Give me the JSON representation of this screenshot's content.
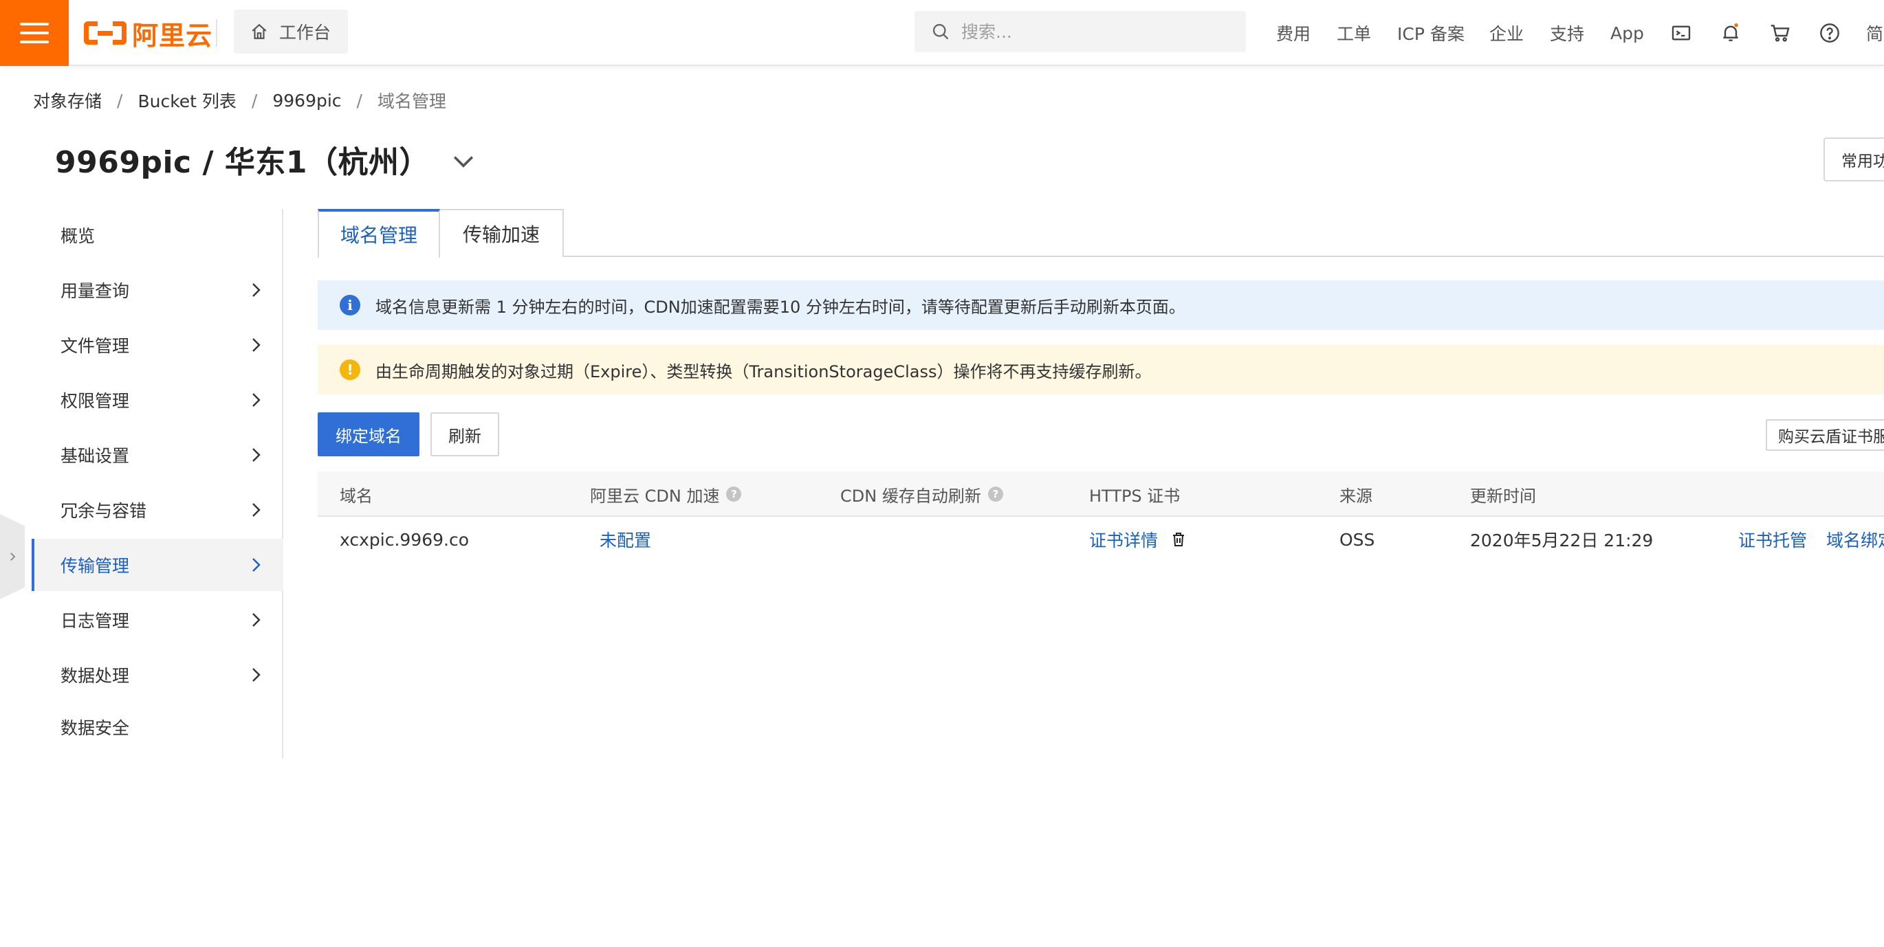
{
  "topbar": {
    "logo_text": "阿里云",
    "workbench_label": "工作台",
    "search_placeholder": "搜索...",
    "nav": [
      "费用",
      "工单",
      "ICP 备案",
      "企业",
      "支持",
      "App"
    ],
    "lang_label": "简",
    "icons": [
      "terminal-icon",
      "bell-icon",
      "cart-icon",
      "help-icon"
    ],
    "notification_dot_color": "#ff6a00"
  },
  "breadcrumb": [
    "对象存储",
    "Bucket 列表",
    "9969pic",
    "域名管理"
  ],
  "page_title": "9969pic / 华东1（杭州）",
  "common_functions_label": "常用功",
  "sidemenu": {
    "items": [
      {
        "label": "概览",
        "has_arrow": false
      },
      {
        "label": "用量查询",
        "has_arrow": true
      },
      {
        "label": "文件管理",
        "has_arrow": true
      },
      {
        "label": "权限管理",
        "has_arrow": true
      },
      {
        "label": "基础设置",
        "has_arrow": true
      },
      {
        "label": "冗余与容错",
        "has_arrow": true
      },
      {
        "label": "传输管理",
        "has_arrow": true,
        "active": true
      },
      {
        "label": "日志管理",
        "has_arrow": true
      },
      {
        "label": "数据处理",
        "has_arrow": true
      },
      {
        "label": "数据安全",
        "has_arrow": false
      }
    ]
  },
  "tabs": [
    {
      "label": "域名管理",
      "active": true
    },
    {
      "label": "传输加速",
      "active": false
    }
  ],
  "alerts": {
    "info": "域名信息更新需 1 分钟左右的时间，CDN加速配置需要10 分钟左右时间，请等待配置更新后手动刷新本页面。",
    "warning": "由生命周期触发的对象过期（Expire）、类型转换（TransitionStorageClass）操作将不再支持缓存刷新。"
  },
  "buttons": {
    "bind_domain": "绑定域名",
    "refresh": "刷新",
    "buy_cert": "购买云盾证书服"
  },
  "table": {
    "columns": [
      "域名",
      "阿里云 CDN 加速",
      "CDN 缓存自动刷新",
      "HTTPS 证书",
      "来源",
      "更新时间"
    ],
    "rows": [
      {
        "domain": "xcxpic.9969.co",
        "cdn": "未配置",
        "cdn_refresh": "",
        "https": "证书详情",
        "source": "OSS",
        "updated": "2020年5月22日 21:29",
        "actions": [
          "证书托管",
          "域名绑定"
        ]
      }
    ]
  },
  "colors": {
    "brand": "#ff6a00",
    "primary": "#2f6fd6",
    "info_bg": "#e8f2fd",
    "warn_bg": "#fef7e1",
    "warn_icon": "#f5b60b"
  }
}
